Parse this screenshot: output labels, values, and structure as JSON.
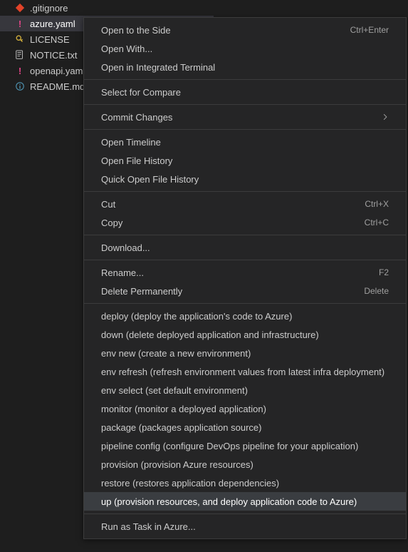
{
  "files": [
    {
      "name": ".gitignore",
      "icon": "gitignore"
    },
    {
      "name": "azure.yaml",
      "icon": "yaml",
      "selected": true
    },
    {
      "name": "LICENSE",
      "icon": "license"
    },
    {
      "name": "NOTICE.txt",
      "icon": "notice"
    },
    {
      "name": "openapi.yaml",
      "icon": "yaml"
    },
    {
      "name": "README.md",
      "icon": "readme"
    }
  ],
  "menu": {
    "groups": [
      [
        {
          "label": "Open to the Side",
          "shortcut": "Ctrl+Enter"
        },
        {
          "label": "Open With..."
        },
        {
          "label": "Open in Integrated Terminal"
        }
      ],
      [
        {
          "label": "Select for Compare"
        }
      ],
      [
        {
          "label": "Commit Changes",
          "submenu": true
        }
      ],
      [
        {
          "label": "Open Timeline"
        },
        {
          "label": "Open File History"
        },
        {
          "label": "Quick Open File History"
        }
      ],
      [
        {
          "label": "Cut",
          "shortcut": "Ctrl+X"
        },
        {
          "label": "Copy",
          "shortcut": "Ctrl+C"
        }
      ],
      [
        {
          "label": "Download..."
        }
      ],
      [
        {
          "label": "Rename...",
          "shortcut": "F2"
        },
        {
          "label": "Delete Permanently",
          "shortcut": "Delete"
        }
      ],
      [
        {
          "label": "deploy (deploy the application's code to Azure)"
        },
        {
          "label": "down (delete deployed application and infrastructure)"
        },
        {
          "label": "env new (create a new environment)"
        },
        {
          "label": "env refresh (refresh environment values from latest infra deployment)"
        },
        {
          "label": "env select (set default environment)"
        },
        {
          "label": "monitor (monitor a deployed application)"
        },
        {
          "label": "package (packages application source)"
        },
        {
          "label": "pipeline config (configure DevOps pipeline for your application)"
        },
        {
          "label": "provision (provision Azure resources)"
        },
        {
          "label": "restore (restores application dependencies)"
        },
        {
          "label": "up (provision resources, and deploy application code to Azure)",
          "highlighted": true
        }
      ],
      [
        {
          "label": "Run as Task in Azure..."
        }
      ]
    ]
  }
}
